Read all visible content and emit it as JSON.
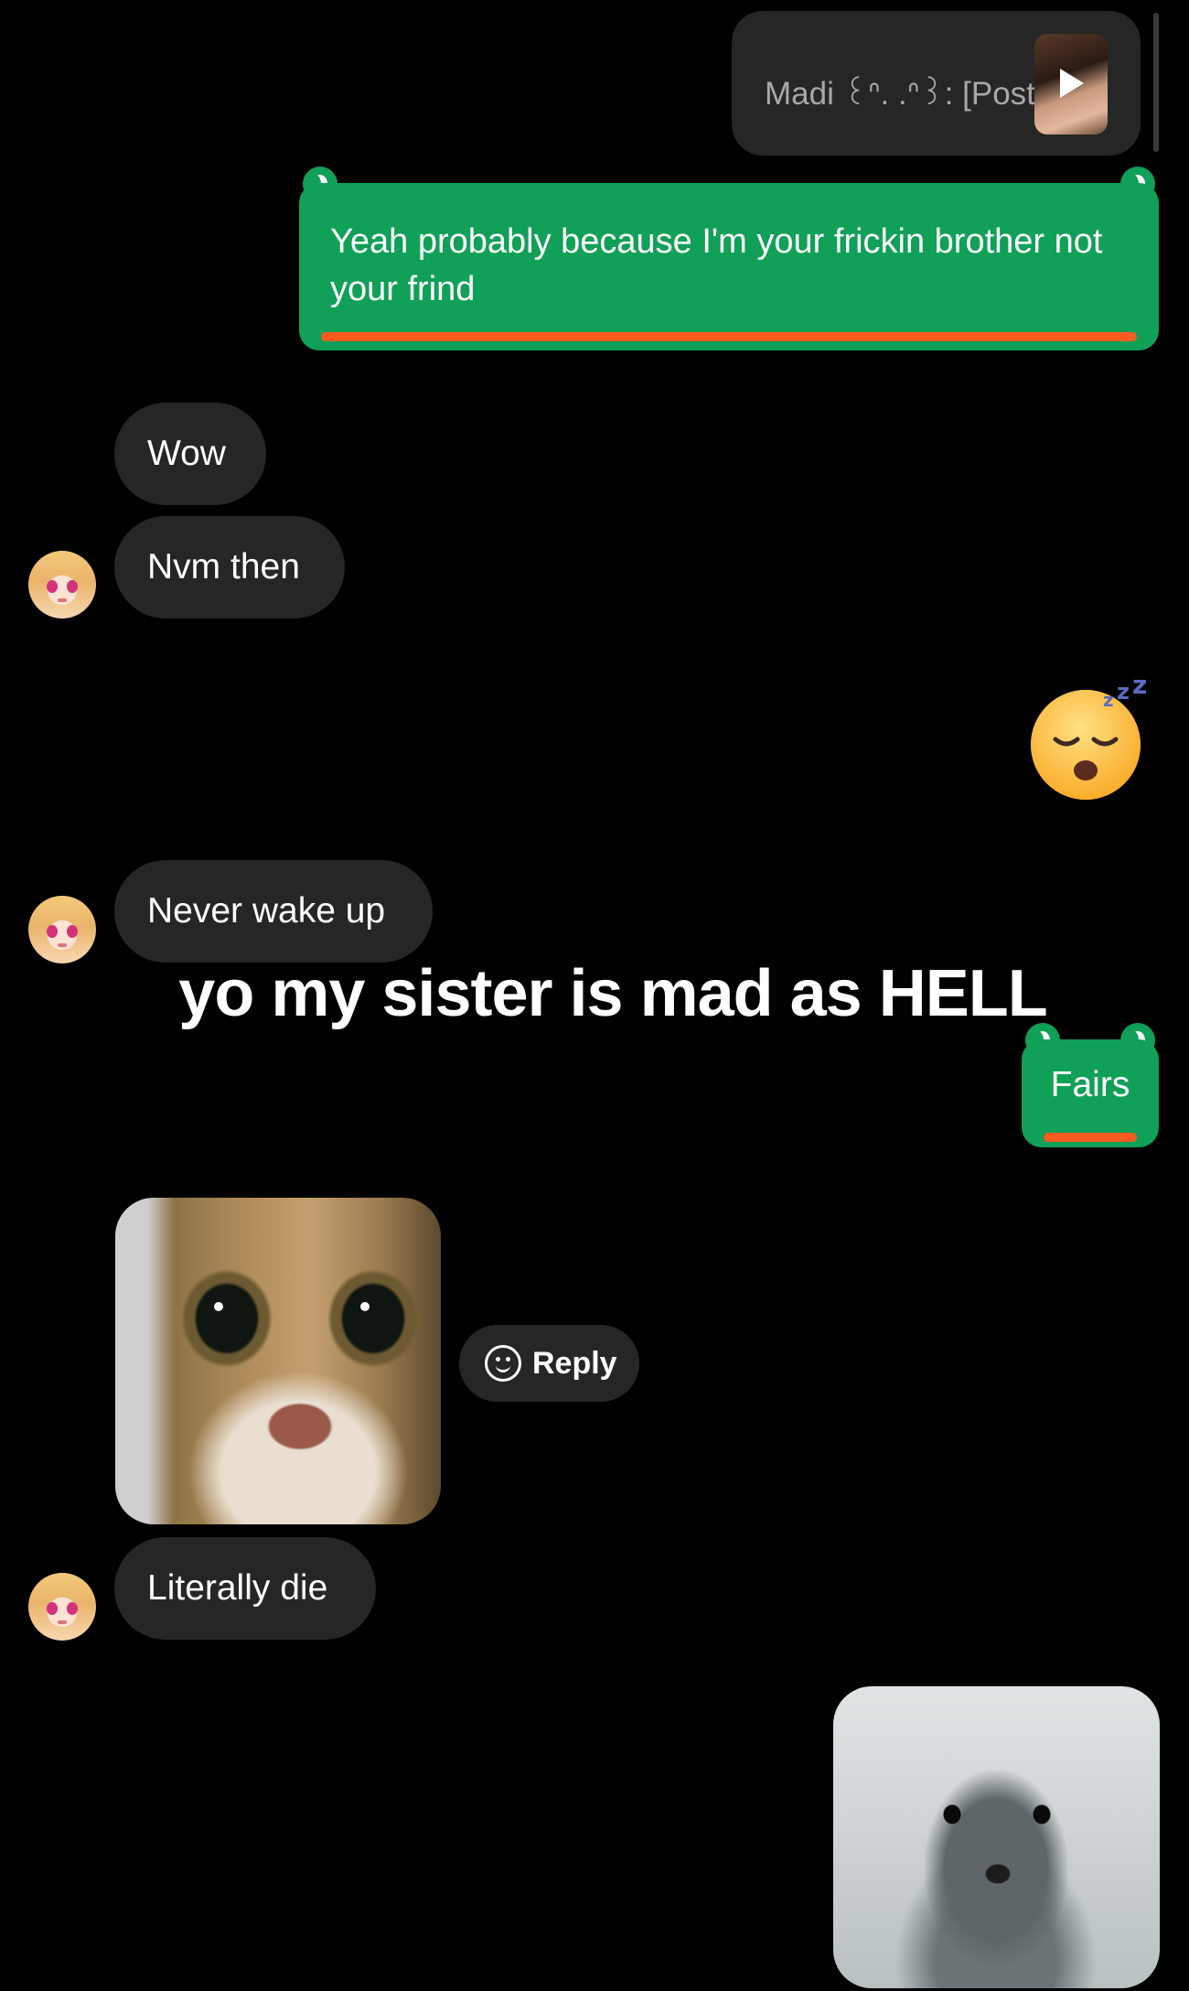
{
  "shared_post": {
    "text": "Madi ꒰ᐢ. .ᐢ꒱: [Post]",
    "icon": "play-icon"
  },
  "messages": [
    {
      "from": "me",
      "style": "green",
      "text": "Yeah probably because I'm your frickin brother not your frind"
    },
    {
      "from": "them",
      "text": "Wow"
    },
    {
      "from": "them",
      "text": "Nvm then"
    },
    {
      "from": "me",
      "emoji": "😴"
    },
    {
      "from": "them",
      "text": "Never wake up"
    },
    {
      "from": "me",
      "style": "green",
      "text": "Fairs"
    },
    {
      "from": "them",
      "image": "cat-photo"
    },
    {
      "from": "them",
      "text": "Literally die"
    },
    {
      "from": "me",
      "image": "dog-photo"
    }
  ],
  "overlay_caption": "yo my sister is mad as HELL",
  "reply_chip": {
    "label": "Reply",
    "icon": "smiley-icon"
  },
  "colors": {
    "background": "#000000",
    "incoming_bubble": "#262626",
    "green_bubble": "#10a057",
    "underline": "#ff5a1f"
  }
}
